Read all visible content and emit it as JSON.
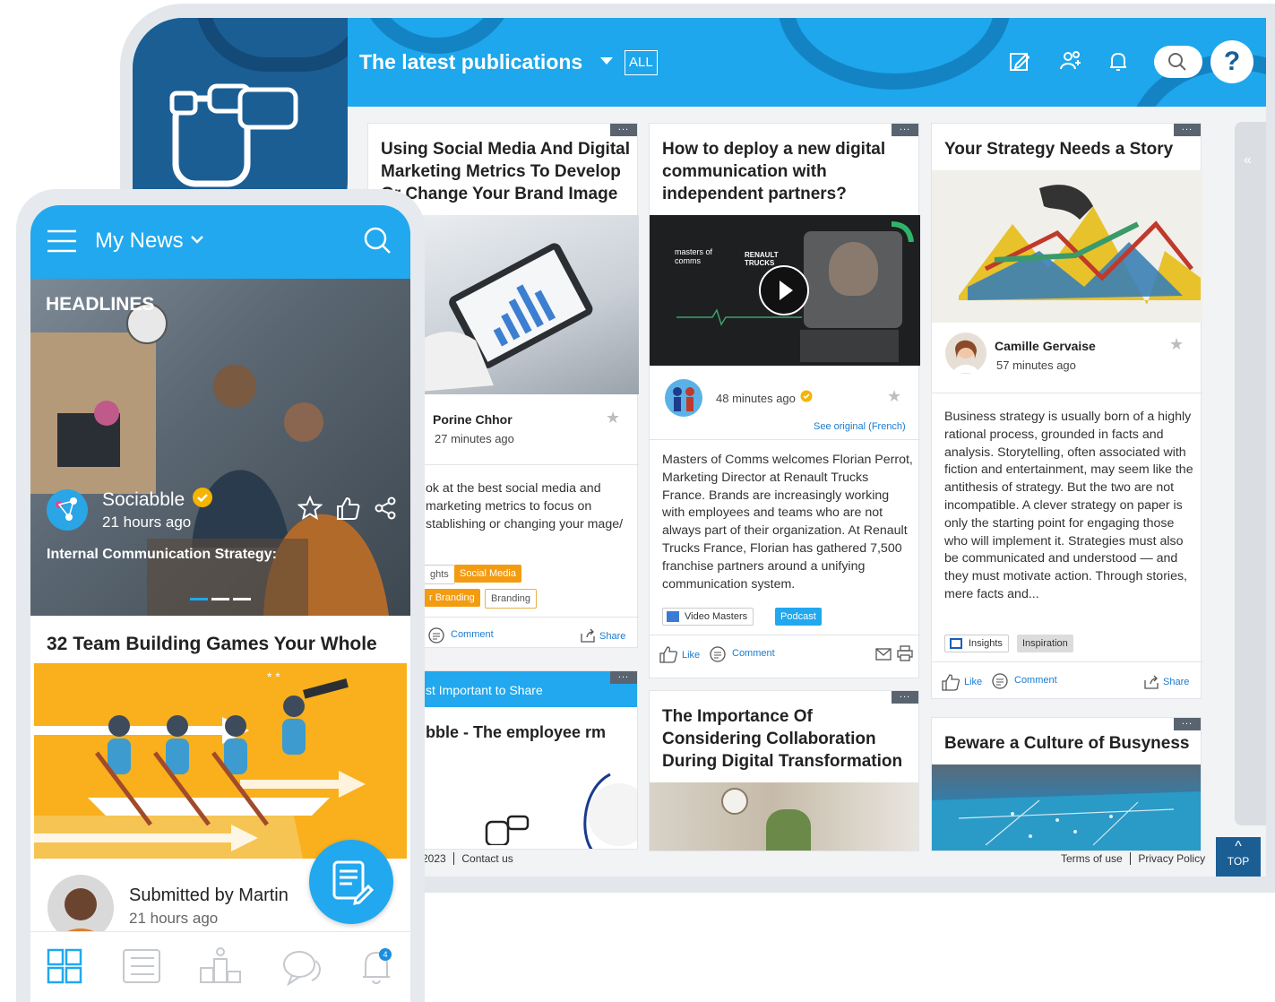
{
  "desktop": {
    "title": "The latest publications",
    "filter": "ALL",
    "icons": [
      "edit-icon",
      "users-icon",
      "bell-icon",
      "search-icon",
      "help-icon"
    ],
    "help_label": "?",
    "cards": [
      {
        "title": "Using Social Media And Digital Marketing Metrics To Develop Or Change Your Brand Image",
        "author": "Porine Chhor",
        "time": "27 minutes ago",
        "body": "ok at the best social media and marketing metrics to focus on stablishing or changing your mage/",
        "tags": [
          "ghts",
          "Social Media",
          "r Branding",
          "Branding"
        ],
        "comment": "Comment",
        "share": "Share"
      },
      {
        "title": "How to deploy a new digital communication with independent partners?",
        "video_brand": "masters of comms",
        "video_partner": "RENAULT TRUCKS",
        "time": "48 minutes ago",
        "see_original": "See original (French)",
        "body": "Masters of Comms welcomes Florian Perrot, Marketing Director at Renault Trucks France. Brands are increasingly working with employees and teams who are not always part of their organization. At Renault Trucks France, Florian has gathered 7,500 franchise partners around a unifying communication system.",
        "source": "Video Masters",
        "tag": "Podcast",
        "like": "Like",
        "comment": "Comment"
      },
      {
        "title": "Your Strategy Needs a Story",
        "author": "Camille Gervaise",
        "time": "57 minutes ago",
        "body": "Business strategy is usually born of a highly rational process, grounded in facts and analysis. Storytelling, often associated with fiction and entertainment, may seem like the antithesis of strategy. But the two are not incompatible. A clever strategy on paper is only the starting point for engaging those who will implement it. Strategies must also be communicated and understood — and they must motivate action. Through stories, mere facts and...",
        "tags": [
          "Insights",
          "Inspiration"
        ],
        "like": "Like",
        "comment": "Comment",
        "share": "Share"
      },
      {
        "header": "st Important to Share",
        "title": "bble - The employee rm"
      },
      {
        "title": "The Importance Of Considering Collaboration During Digital Transformation"
      },
      {
        "title": "Beware a Culture of Busyness"
      }
    ],
    "footer_left": "2023",
    "contact": "Contact us",
    "terms": "Terms of use",
    "privacy": "Privacy Policy",
    "top": "TOP"
  },
  "phone": {
    "title": "My News",
    "section": "HEADLINES",
    "hero": {
      "name": "Sociabble",
      "time": "21 hours ago",
      "subtitle": "Internal Communication Strategy:"
    },
    "card_title": "32 Team Building Games Your Whole",
    "submitted": "Submitted by Martin",
    "submitted_time": "21 hours ago",
    "nav": [
      "dashboard-icon",
      "list-icon",
      "podium-icon",
      "chat-icon",
      "bell-icon"
    ],
    "notif_count": "4"
  },
  "colors": {
    "primary": "#1ea7ec",
    "navy": "#1b5e94",
    "orange": "#f39c12",
    "yellow": "#f9b01c"
  }
}
